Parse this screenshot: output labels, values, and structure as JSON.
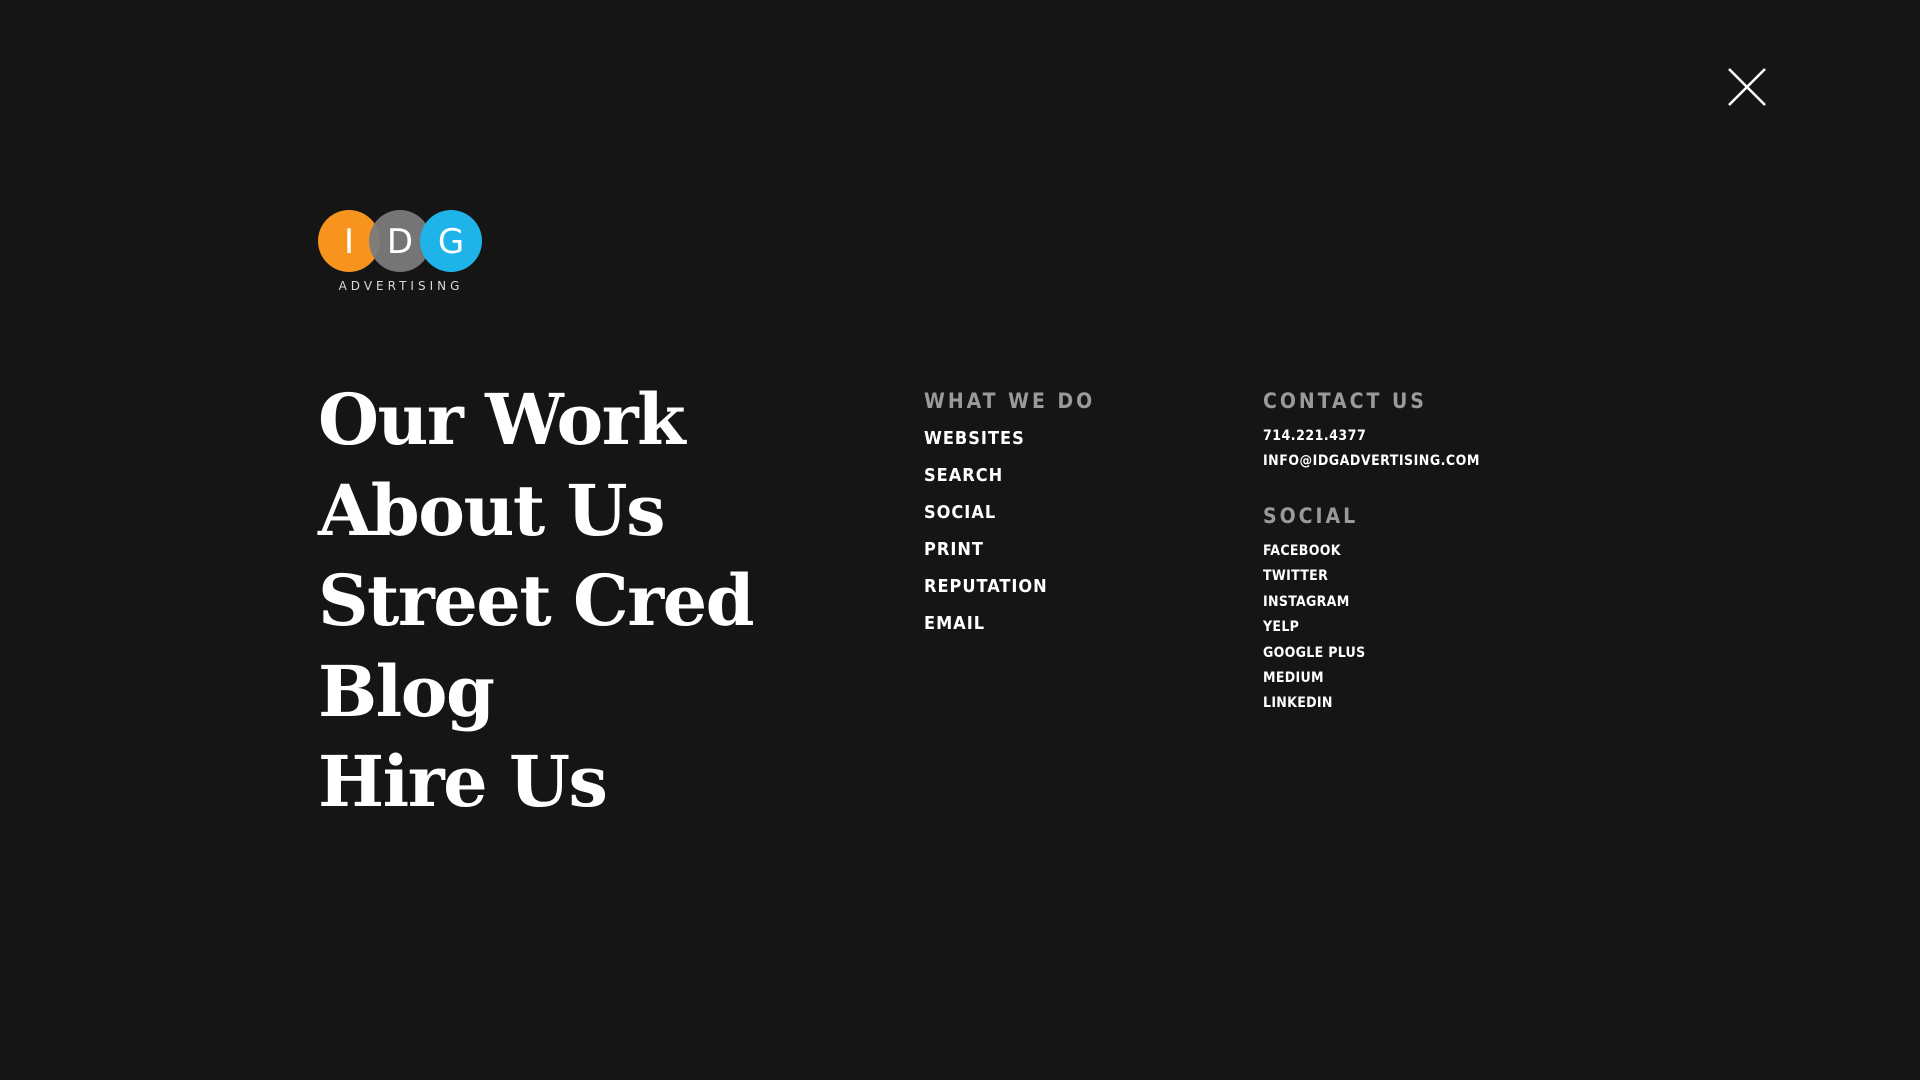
{
  "colors": {
    "background": "#151515",
    "logo_orange": "#F7941D",
    "logo_gray": "#7A7A7A",
    "logo_blue": "#1EB4EA",
    "heading_gray": "#9A9A9A"
  },
  "close": {
    "icon": "close-icon"
  },
  "logo": {
    "letters": [
      "I",
      "D",
      "G"
    ],
    "subtitle": "ADVERTISING"
  },
  "main_nav": [
    {
      "label": "Our Work"
    },
    {
      "label": "About Us"
    },
    {
      "label": "Street Cred"
    },
    {
      "label": "Blog"
    },
    {
      "label": "Hire Us"
    }
  ],
  "what_we_do": {
    "heading": "WHAT WE DO",
    "items": [
      {
        "label": "WEBSITES"
      },
      {
        "label": "SEARCH"
      },
      {
        "label": "SOCIAL"
      },
      {
        "label": "PRINT"
      },
      {
        "label": "REPUTATION"
      },
      {
        "label": "EMAIL"
      }
    ]
  },
  "contact": {
    "heading": "CONTACT US",
    "phone": "714.221.4377",
    "email": "INFO@IDGADVERTISING.COM"
  },
  "social": {
    "heading": "SOCIAL",
    "items": [
      {
        "label": "FACEBOOK"
      },
      {
        "label": "TWITTER"
      },
      {
        "label": "INSTAGRAM"
      },
      {
        "label": "YELP"
      },
      {
        "label": "GOOGLE PLUS"
      },
      {
        "label": "MEDIUM"
      },
      {
        "label": "LINKEDIN"
      }
    ]
  }
}
